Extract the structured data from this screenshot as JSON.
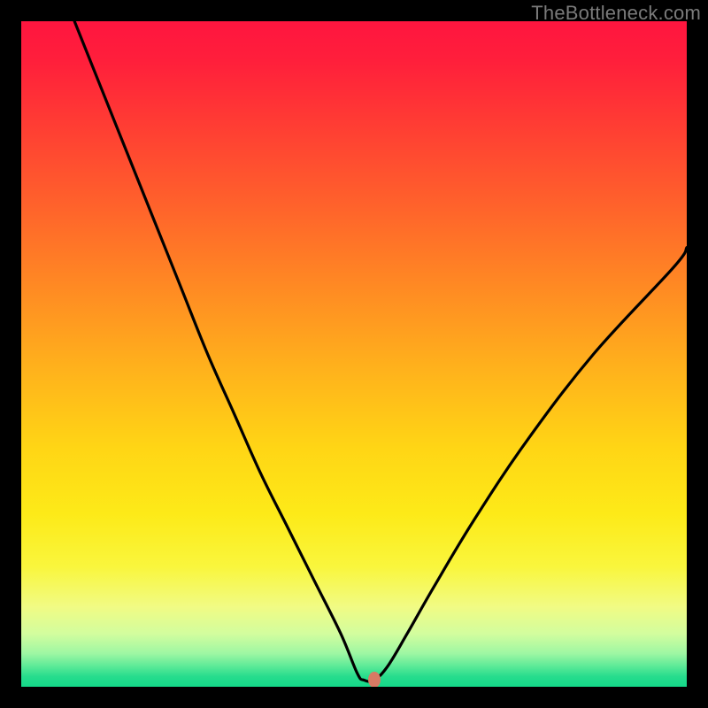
{
  "watermark": "TheBottleneck.com",
  "chart_data": {
    "type": "line",
    "title": "",
    "xlabel": "",
    "ylabel": "",
    "xlim": [
      0,
      100
    ],
    "ylim": [
      0,
      100
    ],
    "grid": false,
    "legend": false,
    "background_gradient": {
      "direction": "vertical",
      "top_color": "#ff153f",
      "mid_color": "#ffd515",
      "bottom_color": "#14d889"
    },
    "series": [
      {
        "name": "bottleneck-curve",
        "color": "#000000",
        "x": [
          8,
          12,
          16,
          20,
          24,
          28,
          32,
          36,
          40,
          44,
          48,
          50.5,
          51.5,
          53,
          55,
          58,
          62,
          68,
          76,
          86,
          98,
          100
        ],
        "y": [
          100,
          90,
          80,
          70,
          60,
          50,
          41,
          32,
          24,
          16,
          8,
          2,
          1,
          1,
          3,
          8,
          15,
          25,
          37,
          50,
          63,
          66
        ]
      }
    ],
    "annotations": [
      {
        "name": "optimal-marker",
        "x": 53,
        "y": 1,
        "color": "#d97a64"
      }
    ]
  }
}
